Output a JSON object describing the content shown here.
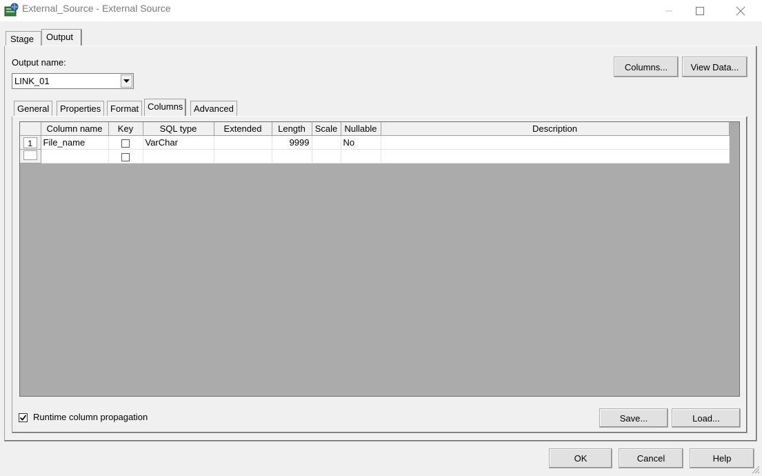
{
  "window": {
    "title": "External_Source - External Source",
    "controls": [
      "minimize-icon",
      "maximize-icon",
      "close-icon"
    ]
  },
  "outer_tabs": [
    {
      "label": "Stage",
      "active": false
    },
    {
      "label": "Output",
      "active": true
    }
  ],
  "output": {
    "label": "Output name:",
    "selected_link": "LINK_01",
    "columns_button": "Columns...",
    "view_data_button": "View Data..."
  },
  "inner_tabs": [
    {
      "label": "General",
      "active": false
    },
    {
      "label": "Properties",
      "active": false
    },
    {
      "label": "Format",
      "active": false
    },
    {
      "label": "Columns",
      "active": true
    },
    {
      "label": "Advanced",
      "active": false
    }
  ],
  "grid": {
    "headers": [
      "Column name",
      "Key",
      "SQL type",
      "Extended",
      "Length",
      "Scale",
      "Nullable",
      "Description"
    ],
    "rows": [
      {
        "row_number": "1",
        "column_name": "File_name",
        "key": false,
        "sql_type": "VarChar",
        "extended": "",
        "length": "9999",
        "scale": "",
        "nullable": "No",
        "description": ""
      },
      {
        "row_number": "",
        "column_name": "",
        "key": false,
        "sql_type": "",
        "extended": "",
        "length": "",
        "scale": "",
        "nullable": "",
        "description": ""
      }
    ]
  },
  "runtime_propagation": {
    "label": "Runtime column propagation",
    "checked": true
  },
  "panel_buttons": {
    "save": "Save...",
    "load": "Load..."
  },
  "dialog_buttons": {
    "ok": "OK",
    "cancel": "Cancel",
    "help": "Help"
  },
  "colors": {
    "grid_background": "#ababab",
    "title_text": "#7a7a7a",
    "dialog_background": "#f0f0f0"
  }
}
